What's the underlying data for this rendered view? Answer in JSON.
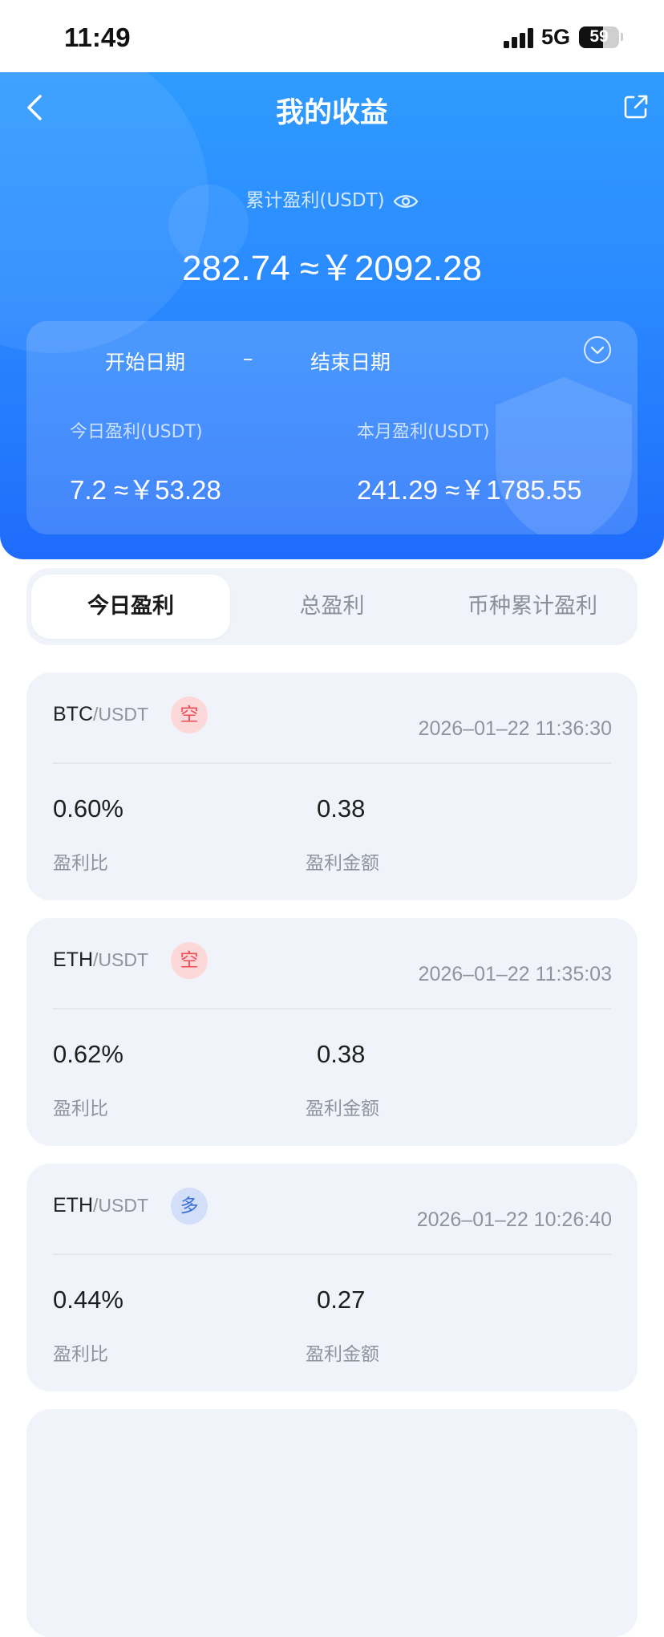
{
  "status_bar": {
    "time": "11:49",
    "network": "5G",
    "battery": "59",
    "battery_level": 0.59
  },
  "header": {
    "title": "我的收益",
    "total_label": "累计盈利(USDT)",
    "total_value": "282.74 ≈￥2092.28"
  },
  "summary": {
    "start_date": "开始日期",
    "separator": "–",
    "end_date": "结束日期",
    "today_label": "今日盈利(USDT)",
    "today_value": "7.2 ≈￥53.28",
    "month_label": "本月盈利(USDT)",
    "month_value": "241.29 ≈￥1785.55"
  },
  "tabs": [
    {
      "label": "今日盈利",
      "active": true
    },
    {
      "label": "总盈利",
      "active": false
    },
    {
      "label": "币种累计盈利",
      "active": false
    }
  ],
  "records": [
    {
      "base": "BTC",
      "quote": "/USDT",
      "side": "空",
      "side_type": "short",
      "time": "2026–01–22 11:36:30",
      "ratio": "0.60%",
      "ratio_label": "盈利比",
      "amount": "0.38",
      "amount_label": "盈利金额"
    },
    {
      "base": "ETH",
      "quote": "/USDT",
      "side": "空",
      "side_type": "short",
      "time": "2026–01–22 11:35:03",
      "ratio": "0.62%",
      "ratio_label": "盈利比",
      "amount": "0.38",
      "amount_label": "盈利金额"
    },
    {
      "base": "ETH",
      "quote": "/USDT",
      "side": "多",
      "side_type": "long",
      "time": "2026–01–22 10:26:40",
      "ratio": "0.44%",
      "ratio_label": "盈利比",
      "amount": "0.27",
      "amount_label": "盈利金额"
    }
  ],
  "colors": {
    "header_top": "#2f9bff",
    "header_bottom": "#1f6cfb",
    "short_badge": "#ee4b55",
    "long_badge": "#3a6fd8",
    "card_bg": "#f0f3f9"
  },
  "icons": [
    "back-chevron-icon",
    "share-icon",
    "eye-icon",
    "chevron-down-circle-icon"
  ]
}
